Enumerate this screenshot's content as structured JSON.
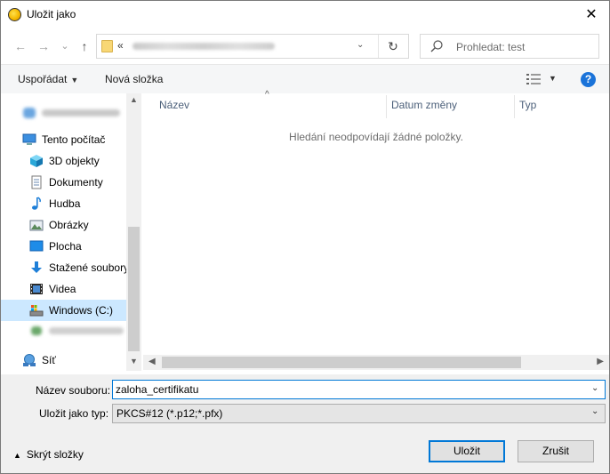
{
  "window": {
    "title": "Uložit jako",
    "close_glyph": "✕"
  },
  "nav": {
    "back_glyph": "←",
    "forward_glyph": "→",
    "recent_glyph": "⌄",
    "up_glyph": "↑",
    "address_prefix": "«",
    "address_dropdown_glyph": "⌄",
    "refresh_glyph": "↻",
    "search_placeholder": "Prohledat: test"
  },
  "toolbar": {
    "organize_label": "Uspořádat",
    "new_folder_label": "Nová složka",
    "help_glyph": "?"
  },
  "sidebar": {
    "items": [
      {
        "label": "Tento počítač",
        "icon": "computer-icon"
      },
      {
        "label": "3D objekty",
        "icon": "cube-icon"
      },
      {
        "label": "Dokumenty",
        "icon": "document-icon"
      },
      {
        "label": "Hudba",
        "icon": "music-icon"
      },
      {
        "label": "Obrázky",
        "icon": "pictures-icon"
      },
      {
        "label": "Plocha",
        "icon": "desktop-icon"
      },
      {
        "label": "Stažené soubory",
        "icon": "download-icon"
      },
      {
        "label": "Videa",
        "icon": "video-icon"
      },
      {
        "label": "Windows (C:)",
        "icon": "drive-icon",
        "selected": true
      },
      {
        "label": "Síť",
        "icon": "network-icon"
      }
    ]
  },
  "file_list": {
    "columns": [
      "Název",
      "Datum změny",
      "Typ"
    ],
    "sort_indicator": "^",
    "empty_message": "Hledání neodpovídají žádné položky."
  },
  "form": {
    "filename_label": "Název souboru:",
    "filename_value": "zaloha_certifikatu",
    "filetype_label": "Uložit jako typ:",
    "filetype_value": "PKCS#12 (*.p12;*.pfx)"
  },
  "footer": {
    "hide_folders_label": "Skrýt složky",
    "save_label": "Uložit",
    "cancel_label": "Zrušit"
  },
  "colors": {
    "accent": "#0078d7",
    "selection": "#cce8ff",
    "help": "#1a73d9"
  }
}
